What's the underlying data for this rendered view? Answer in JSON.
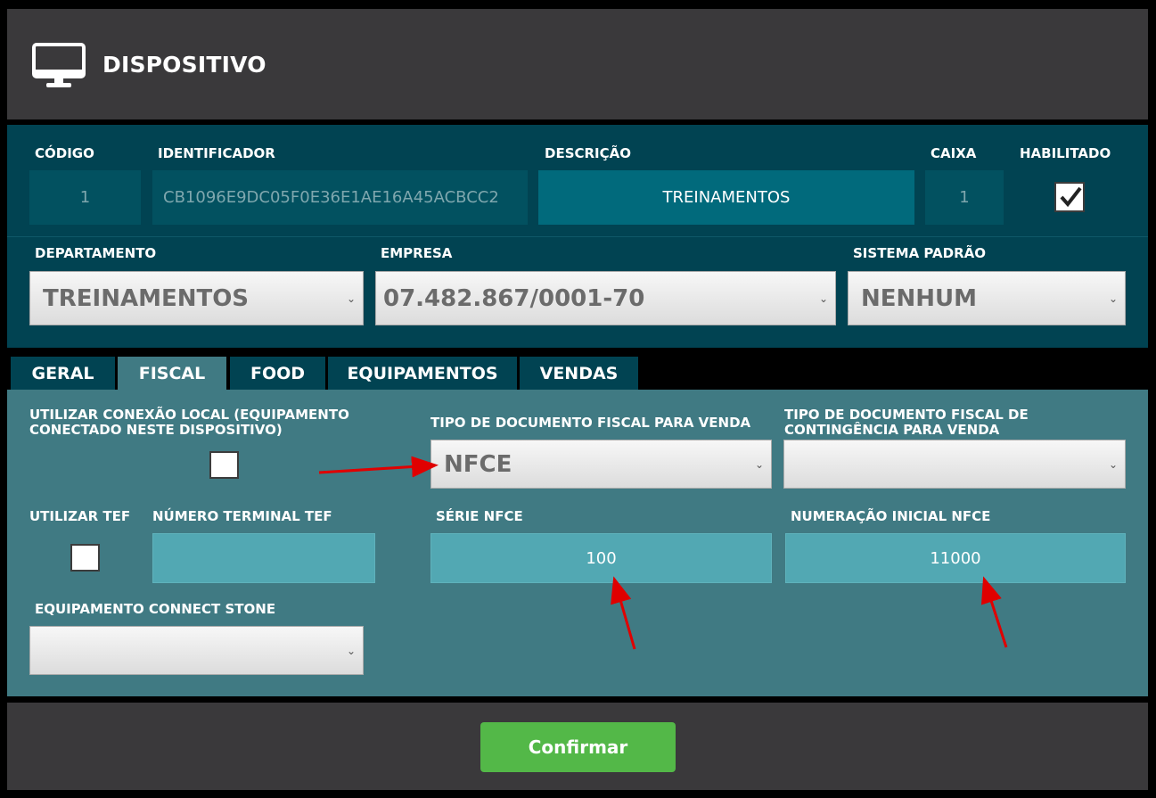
{
  "header": {
    "title": "DISPOSITIVO",
    "icon": "monitor-icon"
  },
  "device": {
    "labels": {
      "codigo": "CÓDIGO",
      "identificador": "IDENTIFICADOR",
      "descricao": "DESCRIÇÃO",
      "caixa": "CAIXA",
      "habilitado": "HABILITADO",
      "departamento": "DEPARTAMENTO",
      "empresa": "EMPRESA",
      "sistema_padrao": "SISTEMA PADRÃO"
    },
    "values": {
      "codigo": "1",
      "identificador": "CB1096E9DC05F0E36E1AE16A45ACBCC2",
      "descricao": "TREINAMENTOS",
      "caixa": "1",
      "habilitado": true,
      "departamento": "TREINAMENTOS",
      "empresa": "07.482.867/0001-70",
      "sistema_padrao": "NENHUM"
    }
  },
  "tabs": [
    {
      "label": "GERAL",
      "active": false
    },
    {
      "label": "FISCAL",
      "active": true
    },
    {
      "label": "FOOD",
      "active": false
    },
    {
      "label": "EQUIPAMENTOS",
      "active": false
    },
    {
      "label": "VENDAS",
      "active": false
    }
  ],
  "fiscal": {
    "labels": {
      "conexao_local": "UTILIZAR CONEXÃO LOCAL (EQUIPAMENTO CONECTADO NESTE DISPOSITIVO)",
      "tipo_doc": "TIPO DE DOCUMENTO FISCAL PARA VENDA",
      "tipo_doc_contingencia": "TIPO DE DOCUMENTO FISCAL DE CONTINGÊNCIA PARA VENDA",
      "utilizar_tef": "UTILIZAR TEF",
      "numero_terminal_tef": "NÚMERO TERMINAL TEF",
      "serie_nfce": "SÉRIE NFCE",
      "numeracao_inicial_nfce": "NUMERAÇÃO INICIAL NFCE",
      "equipamento_connect_stone": "EQUIPAMENTO CONNECT STONE"
    },
    "values": {
      "conexao_local": false,
      "tipo_doc": "NFCE",
      "tipo_doc_contingencia": "",
      "utilizar_tef": false,
      "numero_terminal_tef": "",
      "serie_nfce": "100",
      "numeracao_inicial_nfce": "11000",
      "equipamento_connect_stone": ""
    }
  },
  "footer": {
    "confirm_label": "Confirmar"
  },
  "colors": {
    "header_bg": "#3a393b",
    "panel_dark": "#014352",
    "panel_fiscal": "#407a83",
    "input_teal": "#52a8b3",
    "confirm_green": "#53b848",
    "annotation_arrow": "#e00000"
  }
}
